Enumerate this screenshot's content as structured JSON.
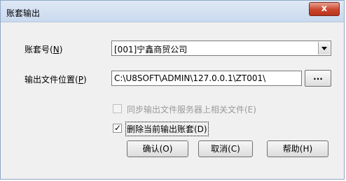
{
  "window": {
    "title": "账套输出",
    "close_glyph": "x"
  },
  "form": {
    "account_set_label": "账套号",
    "account_set_mnemonic": "N",
    "account_set_value": "[001]宁鑫商贸公司",
    "output_location_label": "输出文件位置",
    "output_location_mnemonic": "P",
    "output_location_value": "C:\\U8SOFT\\ADMIN\\127.0.0.1\\ZT001\\",
    "browse_label": "..."
  },
  "options": {
    "sync_files_label": "同步输出文件服务器上相关文件(E)",
    "sync_files_checked": false,
    "sync_files_enabled": false,
    "delete_account_label": "删除当前输出账套(D)",
    "delete_account_checked": true
  },
  "buttons": {
    "ok_label": "确认(O)",
    "cancel_label": "取消(C)",
    "help_label": "帮助(H)"
  },
  "icons": {
    "dropdown": "chevron-down-icon",
    "close": "close-icon",
    "check": "checkmark-icon"
  }
}
